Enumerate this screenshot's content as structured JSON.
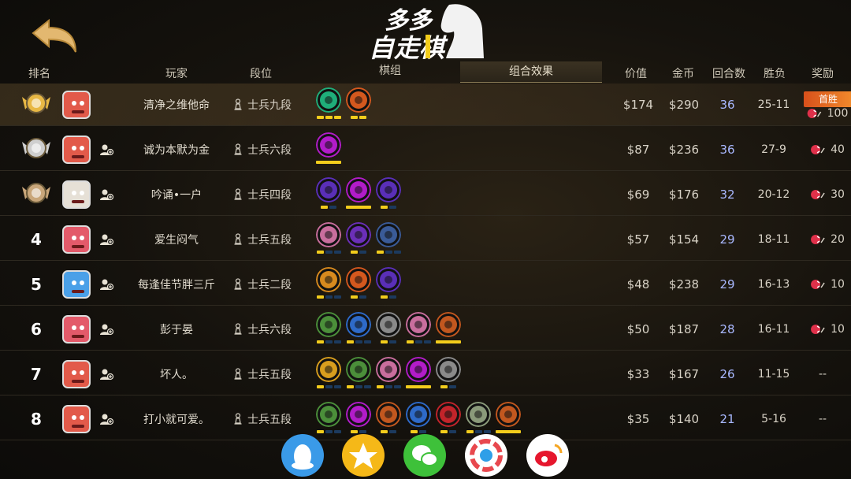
{
  "logo": {
    "line1": "多多",
    "line2": "自走棋"
  },
  "header": {
    "rank": "排名",
    "player": "玩家",
    "tier": "段位",
    "tab_pieces": "棋组",
    "tab_synergy": "组合效果",
    "value": "价值",
    "gold": "金币",
    "rounds": "回合数",
    "win_loss": "胜负",
    "reward": "奖励"
  },
  "first_win_badge": "首胜",
  "rows": [
    {
      "rank": "",
      "name": "清净之维他命",
      "tier": "士兵九段",
      "value": "$174",
      "gold": "$290",
      "rounds": "36",
      "wl": "25-11",
      "reward": "100"
    },
    {
      "rank": "",
      "name": "诚为本默为金",
      "tier": "士兵六段",
      "value": "$87",
      "gold": "$236",
      "rounds": "36",
      "wl": "27-9",
      "reward": "40"
    },
    {
      "rank": "",
      "name": "吟诵•一户",
      "tier": "士兵四段",
      "value": "$69",
      "gold": "$176",
      "rounds": "32",
      "wl": "20-12",
      "reward": "30"
    },
    {
      "rank": "4",
      "name": "爱生闷气",
      "tier": "士兵五段",
      "value": "$57",
      "gold": "$154",
      "rounds": "29",
      "wl": "18-11",
      "reward": "20"
    },
    {
      "rank": "5",
      "name": "每逢佳节胖三斤",
      "tier": "士兵二段",
      "value": "$48",
      "gold": "$238",
      "rounds": "29",
      "wl": "16-13",
      "reward": "10"
    },
    {
      "rank": "6",
      "name": "彭于晏",
      "tier": "士兵六段",
      "value": "$50",
      "gold": "$187",
      "rounds": "28",
      "wl": "16-11",
      "reward": "10"
    },
    {
      "rank": "7",
      "name": "坏人。",
      "tier": "士兵五段",
      "value": "$33",
      "gold": "$167",
      "rounds": "26",
      "wl": "11-15",
      "reward": "--"
    },
    {
      "rank": "8",
      "name": "打小就可爱。",
      "tier": "士兵五段",
      "value": "$35",
      "gold": "$140",
      "rounds": "21",
      "wl": "5-16",
      "reward": "--"
    }
  ],
  "share": [
    "qq-icon",
    "qzone-icon",
    "wechat-icon",
    "moments-icon",
    "weibo-icon"
  ],
  "colors": {
    "accent_gold": "#f3cd1c",
    "rounds_blue": "#a9b8ff",
    "badge_orange": "#e8641f"
  }
}
